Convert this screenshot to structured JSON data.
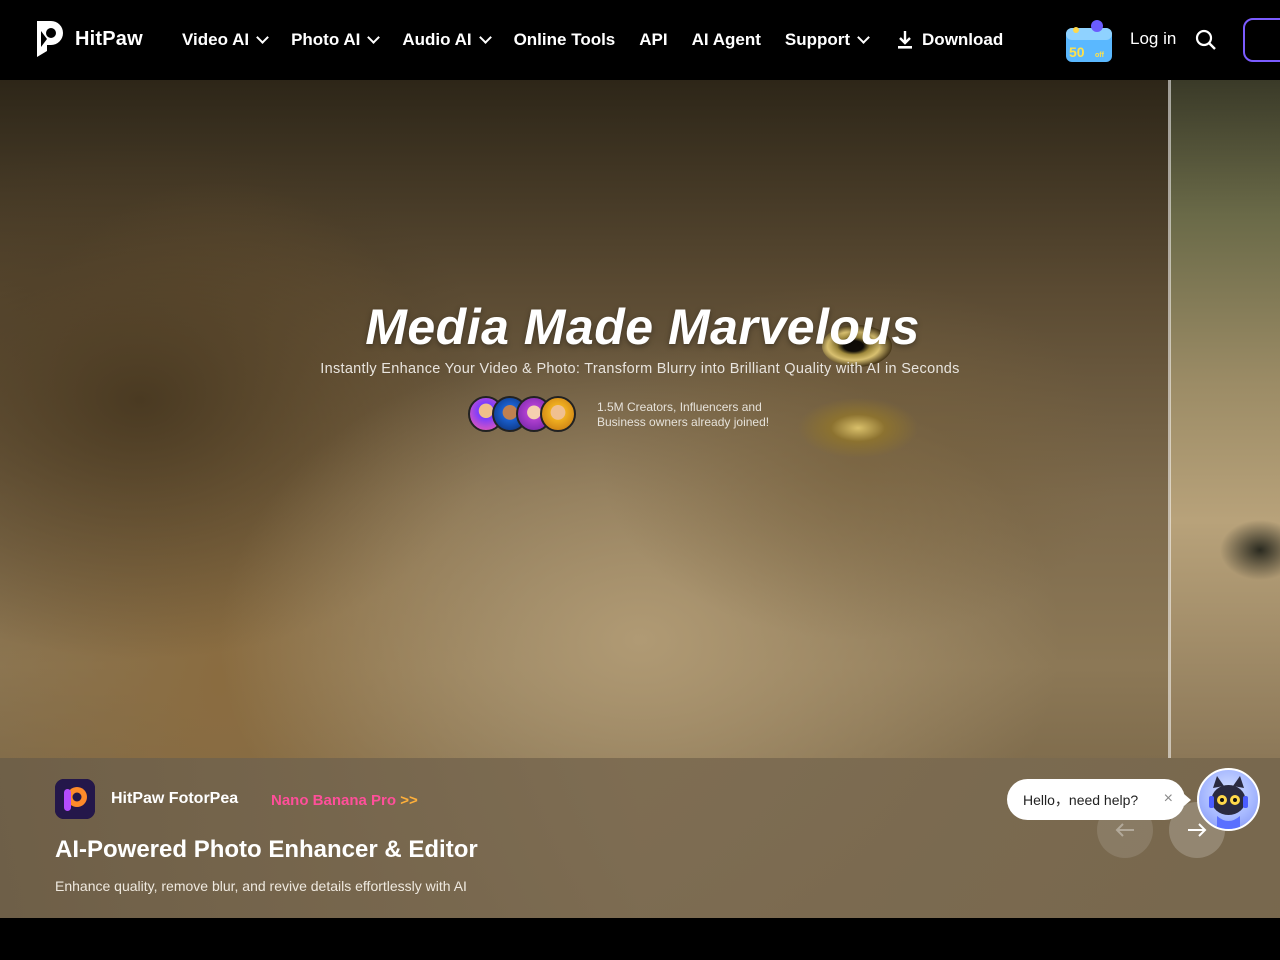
{
  "nav": {
    "brand": "HitPaw",
    "items": [
      {
        "label": "Video AI",
        "dropdown": true
      },
      {
        "label": "Photo AI",
        "dropdown": true
      },
      {
        "label": "Audio AI",
        "dropdown": true
      },
      {
        "label": "Online Tools",
        "dropdown": false
      },
      {
        "label": "API",
        "dropdown": false
      },
      {
        "label": "AI Agent",
        "dropdown": false
      },
      {
        "label": "Support",
        "dropdown": true
      }
    ],
    "download": "Download",
    "promo_badge": "50",
    "login": "Log in",
    "accent_color": "#7b5cff"
  },
  "hero": {
    "title": "Media Made Marvelous",
    "subtitle": "Instantly Enhance Your Video & Photo: Transform Blurry into Brilliant Quality with AI in Seconds",
    "social_line1": "1.5M Creators, Influencers and",
    "social_line2": "Business owners already joined!"
  },
  "band": {
    "app_name": "HitPaw FotorPea",
    "link_text": "Nano Banana Pro",
    "link_arrows": ">>",
    "title": "AI-Powered Photo Enhancer & Editor",
    "subtitle": "Enhance quality, remove blur, and revive details effortlessly with AI",
    "link_color": "#ff4f9a"
  },
  "chat": {
    "message": "Hello，need help?",
    "close": "×"
  }
}
